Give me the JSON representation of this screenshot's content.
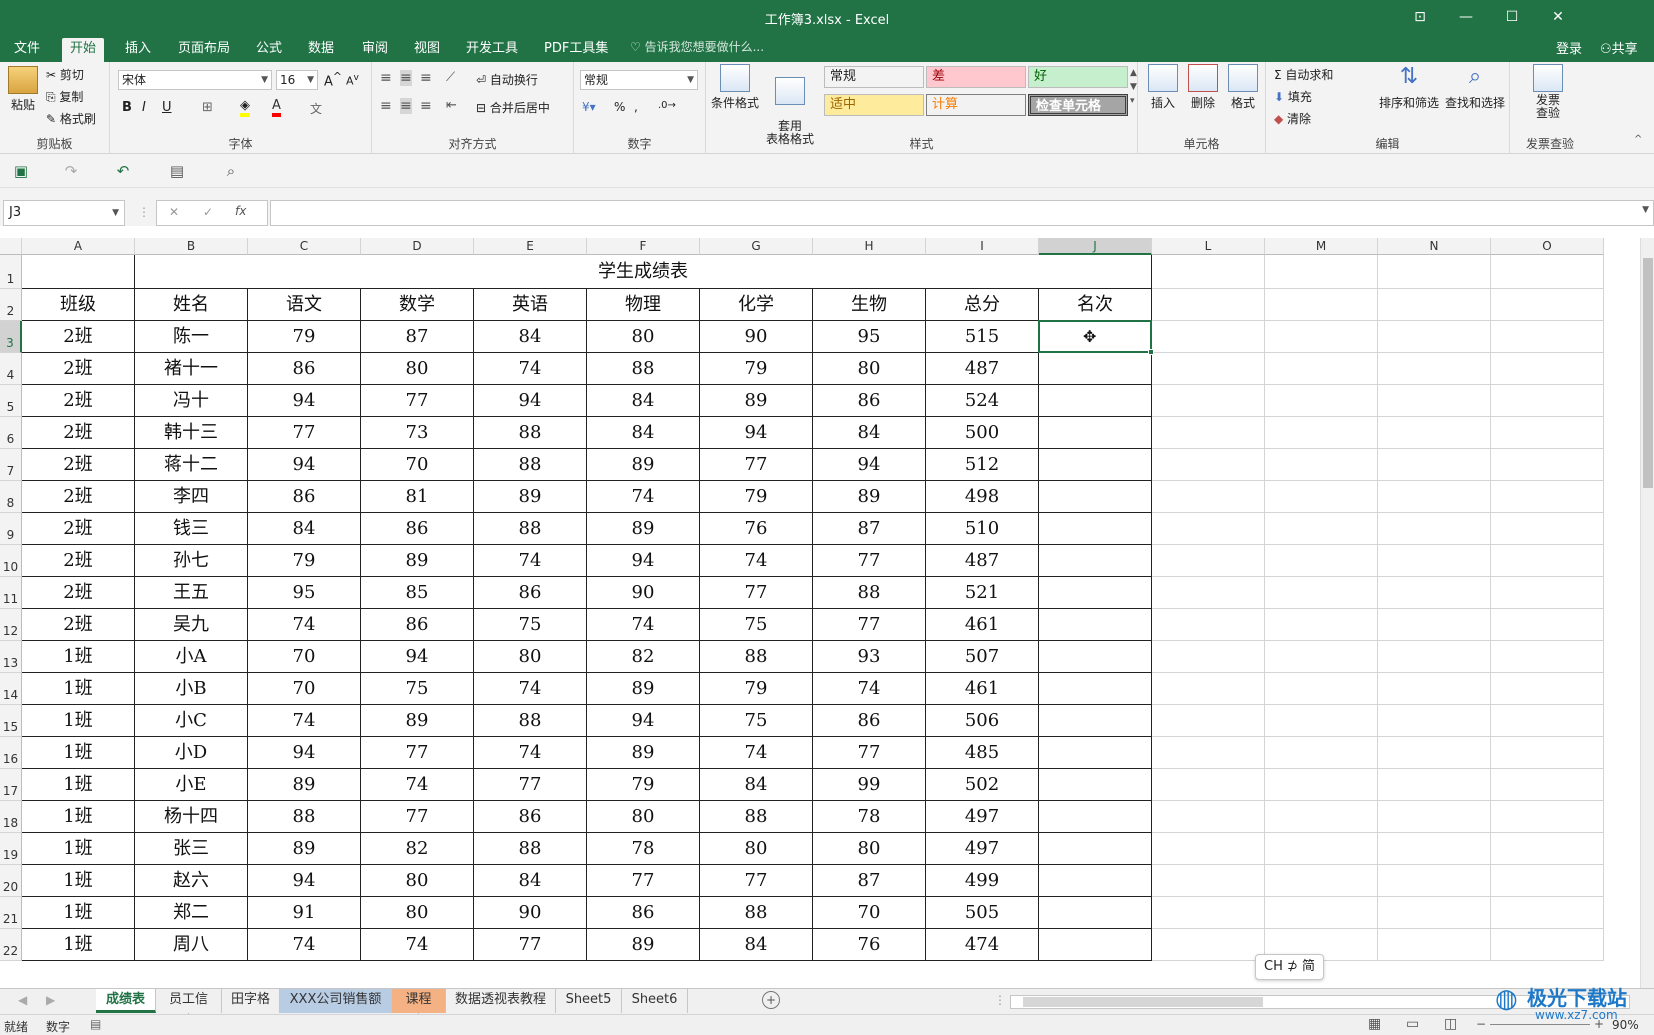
{
  "window": {
    "title": "工作簿3.xlsx - Excel",
    "controls": [
      "⊡",
      "—",
      "☐",
      "✕"
    ]
  },
  "menu_tabs": [
    "文件",
    "开始",
    "插入",
    "页面布局",
    "公式",
    "数据",
    "审阅",
    "视图",
    "开发工具",
    "PDF工具集"
  ],
  "active_tab": "开始",
  "tell_me": "告诉我您想要做什么...",
  "login": "登录",
  "share": "共享",
  "ribbon": {
    "clipboard": {
      "paste": "粘贴",
      "cut": "剪切",
      "copy": "复制",
      "format_painter": "格式刷",
      "label": "剪贴板"
    },
    "font": {
      "name": "宋体",
      "size": "16",
      "label": "字体",
      "bold": "B",
      "italic": "I",
      "underline": "U"
    },
    "alignment": {
      "wrap": "自动换行",
      "merge": "合并后居中",
      "label": "对齐方式"
    },
    "number": {
      "format": "常规",
      "label": "数字",
      "percent": "%",
      "comma": ","
    },
    "styles": {
      "conditional": "条件格式",
      "table": "套用\n表格格式",
      "label": "样式",
      "cells": [
        {
          "text": "常规",
          "bg": "#ffffff",
          "fg": "#000000"
        },
        {
          "text": "差",
          "bg": "#ffc7ce",
          "fg": "#9c0006"
        },
        {
          "text": "好",
          "bg": "#c6efce",
          "fg": "#006100"
        },
        {
          "text": "适中",
          "bg": "#ffeb9c",
          "fg": "#9c6500"
        },
        {
          "text": "计算",
          "bg": "#f2f2f2",
          "fg": "#fa7d00"
        },
        {
          "text": "检查单元格",
          "bg": "#a5a5a5",
          "fg": "#ffffff"
        }
      ]
    },
    "cells_group": {
      "insert": "插入",
      "delete": "删除",
      "format": "格式",
      "label": "单元格"
    },
    "editing": {
      "autosum": "自动求和",
      "fill": "填充",
      "clear": "清除",
      "sort": "排序和筛选",
      "find": "查找和选择",
      "label": "编辑"
    },
    "invoice": {
      "check": "发票\n查验",
      "label": "发票查验"
    }
  },
  "name_box": "J3",
  "fx": "fx",
  "columns": [
    "A",
    "B",
    "C",
    "D",
    "E",
    "F",
    "G",
    "H",
    "I",
    "J",
    "L",
    "M",
    "N",
    "O"
  ],
  "selected_column": "J",
  "selected_row": "3",
  "sheet": {
    "title": "学生成绩表",
    "headers": [
      "班级",
      "姓名",
      "语文",
      "数学",
      "英语",
      "物理",
      "化学",
      "生物",
      "总分",
      "名次"
    ],
    "rows": [
      [
        "2班",
        "陈一",
        "79",
        "87",
        "84",
        "80",
        "90",
        "95",
        "515",
        ""
      ],
      [
        "2班",
        "褚十一",
        "86",
        "80",
        "74",
        "88",
        "79",
        "80",
        "487",
        ""
      ],
      [
        "2班",
        "冯十",
        "94",
        "77",
        "94",
        "84",
        "89",
        "86",
        "524",
        ""
      ],
      [
        "2班",
        "韩十三",
        "77",
        "73",
        "88",
        "84",
        "94",
        "84",
        "500",
        ""
      ],
      [
        "2班",
        "蒋十二",
        "94",
        "70",
        "88",
        "89",
        "77",
        "94",
        "512",
        ""
      ],
      [
        "2班",
        "李四",
        "86",
        "81",
        "89",
        "74",
        "79",
        "89",
        "498",
        ""
      ],
      [
        "2班",
        "钱三",
        "84",
        "86",
        "88",
        "89",
        "76",
        "87",
        "510",
        ""
      ],
      [
        "2班",
        "孙七",
        "79",
        "89",
        "74",
        "94",
        "74",
        "77",
        "487",
        ""
      ],
      [
        "2班",
        "王五",
        "95",
        "85",
        "86",
        "90",
        "77",
        "88",
        "521",
        ""
      ],
      [
        "2班",
        "吴九",
        "74",
        "86",
        "75",
        "74",
        "75",
        "77",
        "461",
        ""
      ],
      [
        "1班",
        "小A",
        "70",
        "94",
        "80",
        "82",
        "88",
        "93",
        "507",
        ""
      ],
      [
        "1班",
        "小B",
        "70",
        "75",
        "74",
        "89",
        "79",
        "74",
        "461",
        ""
      ],
      [
        "1班",
        "小C",
        "74",
        "89",
        "88",
        "94",
        "75",
        "86",
        "506",
        ""
      ],
      [
        "1班",
        "小D",
        "94",
        "77",
        "74",
        "89",
        "74",
        "77",
        "485",
        ""
      ],
      [
        "1班",
        "小E",
        "89",
        "74",
        "77",
        "79",
        "84",
        "99",
        "502",
        ""
      ],
      [
        "1班",
        "杨十四",
        "88",
        "77",
        "86",
        "80",
        "88",
        "78",
        "497",
        ""
      ],
      [
        "1班",
        "张三",
        "89",
        "82",
        "88",
        "78",
        "80",
        "80",
        "497",
        ""
      ],
      [
        "1班",
        "赵六",
        "94",
        "80",
        "84",
        "77",
        "77",
        "87",
        "499",
        ""
      ],
      [
        "1班",
        "郑二",
        "91",
        "80",
        "90",
        "86",
        "88",
        "70",
        "505",
        ""
      ],
      [
        "1班",
        "周八",
        "74",
        "74",
        "77",
        "89",
        "84",
        "76",
        "474",
        ""
      ]
    ]
  },
  "sheet_tabs": [
    {
      "name": "成绩表",
      "style": "active"
    },
    {
      "name": "员工信息",
      "style": ""
    },
    {
      "name": "田字格",
      "style": ""
    },
    {
      "name": "XXX公司销售额",
      "style": "blue"
    },
    {
      "name": "课程表",
      "style": "orange"
    },
    {
      "name": "数据透视表教程",
      "style": ""
    },
    {
      "name": "Sheet5",
      "style": ""
    },
    {
      "name": "Sheet6",
      "style": ""
    }
  ],
  "status": {
    "ready": "就绪",
    "mode": "数字",
    "zoom": "90%"
  },
  "ime": "CH ⊅ 简",
  "watermark": "极光下载站",
  "watermark_url": "www.xz7.com",
  "colors": {
    "accent": "#217346",
    "grid": "#d4d4d4"
  }
}
